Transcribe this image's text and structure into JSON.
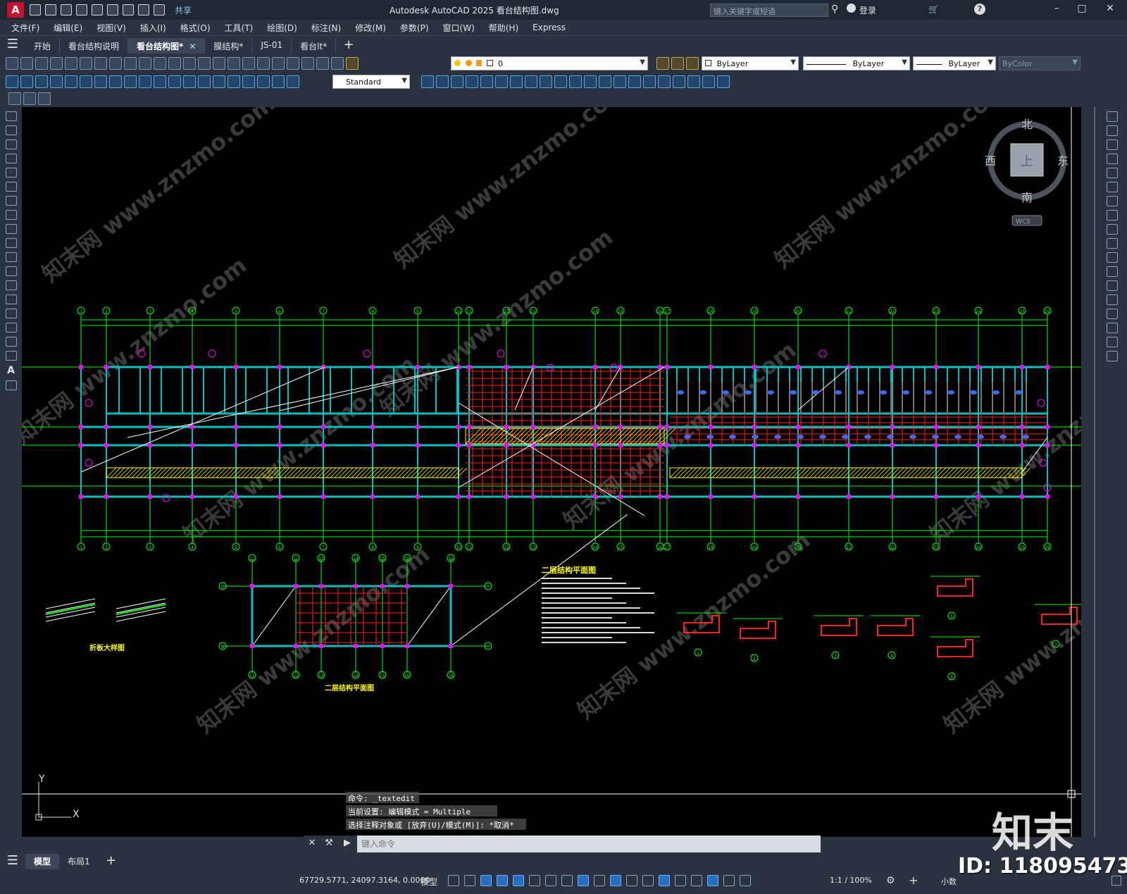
{
  "titlebar": {
    "app_letter": "A",
    "share_label": "共享",
    "title": "Autodesk AutoCAD 2025    看台结构图.dwg",
    "search_placeholder": "键入关键字或短语",
    "login_label": "登录"
  },
  "menu": [
    "文件(F)",
    "编辑(E)",
    "视图(V)",
    "插入(I)",
    "格式(O)",
    "工具(T)",
    "绘图(D)",
    "标注(N)",
    "修改(M)",
    "参数(P)",
    "窗口(W)",
    "帮助(H)",
    "Express"
  ],
  "file_tabs": [
    {
      "label": "开始",
      "active": false
    },
    {
      "label": "看台结构说明",
      "active": false
    },
    {
      "label": "看台结构图*",
      "active": true
    },
    {
      "label": "膜结构*",
      "active": false
    },
    {
      "label": "JS-01",
      "active": false
    },
    {
      "label": "看台lt*",
      "active": false
    }
  ],
  "layer_toolbar": {
    "layer_value": "0",
    "color_value": "ByLayer",
    "linetype_value": "ByLayer",
    "lineweight_value": "ByLayer",
    "plotstyle_value": "ByColor",
    "textstyle_value": "Standard"
  },
  "viewcube": {
    "north": "北",
    "south": "南",
    "east": "东",
    "west": "西",
    "top": "上",
    "wcs": "WCS"
  },
  "ucs": {
    "y": "Y",
    "x": "X"
  },
  "drawing": {
    "title_second_floor_plan": "二层结构平面图",
    "title_second_floor_plan_small": "二层结构平面图",
    "title_fold_detail": "折板大样图",
    "axis_top": [
      "1",
      "2",
      "3",
      "4",
      "5",
      "6",
      "7",
      "8",
      "9",
      "10",
      "11",
      "12",
      "13",
      "14",
      "15",
      "16",
      "17",
      "18",
      "19",
      "20",
      "21",
      "22",
      "23",
      "24",
      "25",
      "26"
    ],
    "axis_small_top": [
      "11",
      "12",
      "13",
      "14",
      "15",
      "16"
    ],
    "axis_small_side": [
      "C",
      "B"
    ],
    "section_marks": [
      "1",
      "2",
      "3",
      "4",
      "5",
      "6",
      "7"
    ]
  },
  "command": {
    "history": [
      "命令: _textedit",
      "当前设置: 编辑模式 = Multiple",
      "选择注释对象或 [放弃(U)/模式(M)]: *取消*"
    ],
    "placeholder": "键入命令"
  },
  "layout_tabs": [
    {
      "label": "模型",
      "active": true
    },
    {
      "label": "布局1",
      "active": false
    }
  ],
  "status": {
    "coords": "67729.5771, 24097.3164, 0.0000",
    "model_label": "模型",
    "scale": "1:1 / 100%",
    "units": "小数"
  },
  "watermark": {
    "logo_text": "知末",
    "id_text": "ID: 1180954733",
    "diagonal_text": "知末网 www.znzmo.com"
  },
  "colors": {
    "axis_green": "#00ff00",
    "beam_red": "#ff2020",
    "column_magenta": "#ff00ff",
    "wall_cyan": "#00c0c0",
    "leader_white": "#ffffff",
    "hatch_yellow": "#ffff00"
  }
}
